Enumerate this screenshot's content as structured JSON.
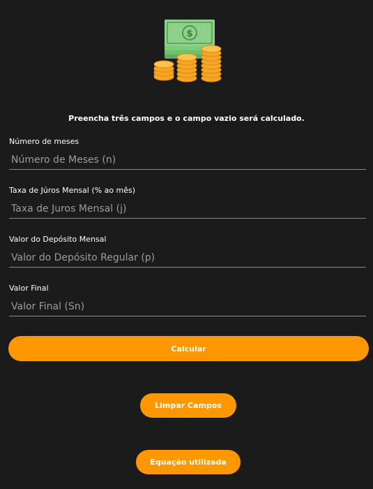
{
  "logo": {
    "icon": "money-coins-icon"
  },
  "instructions": "Preencha três campos e o campo vazio será calculado.",
  "fields": [
    {
      "label": "Número de meses",
      "placeholder": "Número de Meses (n)",
      "value": ""
    },
    {
      "label": "Taxa de Júros Mensal (% ao mês)",
      "placeholder": "Taxa de Juros Mensal (j)",
      "value": ""
    },
    {
      "label": "Valor do Depósito Mensal",
      "placeholder": "Valor do Depósito Regular (p)",
      "value": ""
    },
    {
      "label": "Valor Final",
      "placeholder": "Valor Final (Sn)",
      "value": ""
    }
  ],
  "buttons": {
    "calcular": "Calcular",
    "limpar": "Limpar Campos",
    "equacao": "Equação utilizada"
  },
  "colors": {
    "background": "#1b1b1b",
    "accent": "#ff9800",
    "bill": "#8fd18c",
    "coin": "#f6a623"
  }
}
